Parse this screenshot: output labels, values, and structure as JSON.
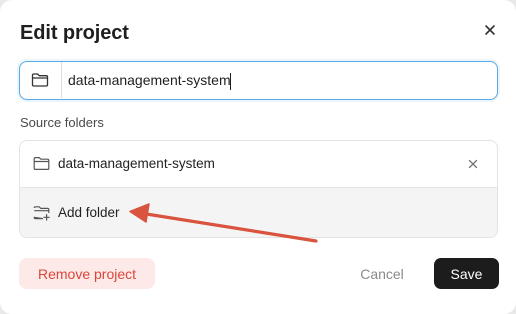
{
  "dialog": {
    "title": "Edit project"
  },
  "name_field": {
    "value": "data-management-system",
    "icon": "folder-icon"
  },
  "source_folders": {
    "label": "Source folders",
    "items": [
      {
        "name": "data-management-system",
        "icon": "folder-icon"
      }
    ],
    "add_label": "Add folder",
    "add_icon": "folder-plus-icon"
  },
  "footer": {
    "remove_label": "Remove project",
    "cancel_label": "Cancel",
    "save_label": "Save"
  },
  "colors": {
    "accent_focus": "#5aa9e6",
    "danger": "#d9463b",
    "danger_bg": "#fde9e8",
    "primary_button": "#1c1c1c",
    "annotation_arrow": "#d9533f"
  }
}
